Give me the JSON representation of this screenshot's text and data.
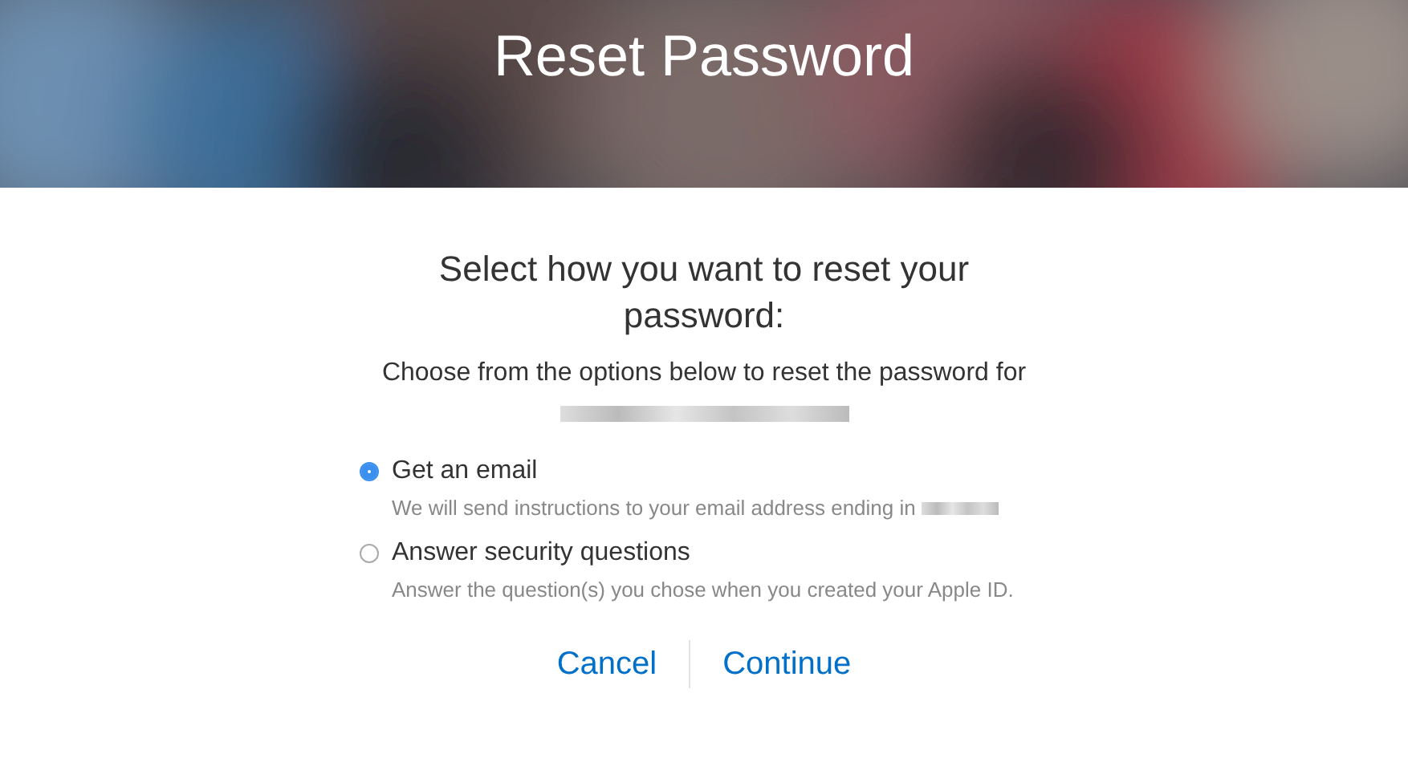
{
  "header": {
    "title": "Reset Password",
    "kind": "picture"
  },
  "heading": "Select how you want to reset your password:",
  "intro": "Choose from the options below to reset the password for",
  "options": [
    {
      "label": "Get an email",
      "description": "We will send instructions to your email address ending in",
      "selected": true
    },
    {
      "label": "Answer security questions",
      "description": "Answer the question(s) you chose when you created your Apple ID.",
      "selected": false
    }
  ],
  "buttons": [
    "Cancel",
    "Continue"
  ]
}
